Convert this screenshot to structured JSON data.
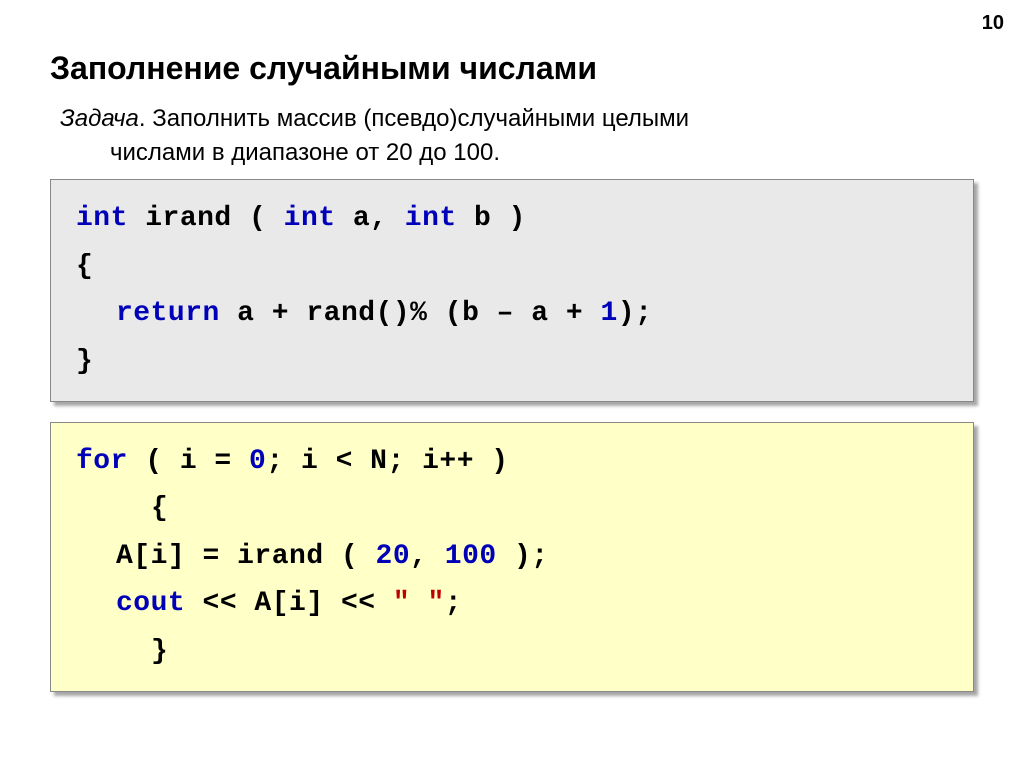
{
  "pageNumber": "10",
  "title": "Заполнение случайными числами",
  "task": {
    "label": "Задача",
    "dot": ". ",
    "line1": "Заполнить массив (псевдо)случайными целыми",
    "line2": "числами в диапазоне от 20 до 100."
  },
  "code1": {
    "t1": "int",
    "t2": " irand ( ",
    "t3": "int",
    "t4": " a, ",
    "t5": "int",
    "t6": " b )",
    "t7": "{",
    "t8": "return",
    "t9": " a + rand()% (b – a + ",
    "t10": "1",
    "t11": ");",
    "t12": "}"
  },
  "code2": {
    "t1": "for",
    "t2": " ( i = ",
    "t3": "0",
    "t4": "; i < N; i++ )",
    "t5": "{",
    "t6": "A[i] = irand ( ",
    "t7": "20",
    "t8": ", ",
    "t9": "100",
    "t10": " );",
    "t11": "cout",
    "t12": " << A[i] << ",
    "t13": "\" \"",
    "t14": ";",
    "t15": "}"
  }
}
